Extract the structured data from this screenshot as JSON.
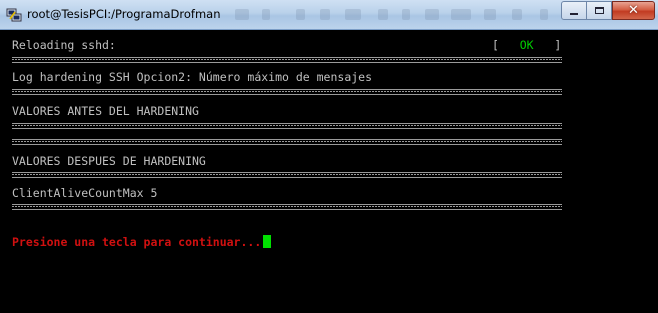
{
  "window": {
    "title": "root@TesisPCI:/ProgramaDrofman",
    "icon": "putty-icon",
    "controls": {
      "minimize_icon": "minimize-icon",
      "maximize_icon": "maximize-icon",
      "close_icon": "close-icon"
    }
  },
  "terminal": {
    "reloading_label": "Reloading sshd:",
    "status_open": "[",
    "status_ok": "OK",
    "status_close": "]",
    "log_heading": "Log hardening SSH Opcion2: Número máximo de mensajes",
    "before_heading": "VALORES ANTES DEL HARDENING",
    "after_heading": "VALORES DESPUES DE HARDENING",
    "after_value": "ClientAliveCountMax 5",
    "prompt_text": "Presione una tecla para continuar...",
    "colors": {
      "background": "#000000",
      "text": "#c0c0c0",
      "ok": "#00d000",
      "prompt": "#d01010",
      "cursor": "#00e000"
    }
  }
}
